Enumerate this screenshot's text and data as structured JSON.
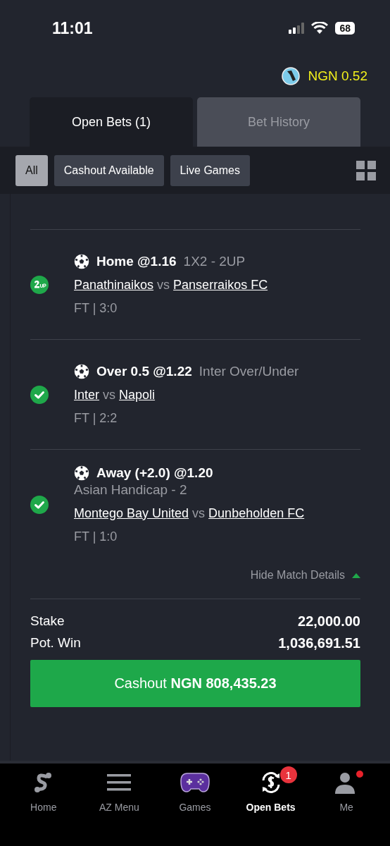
{
  "status_bar": {
    "time": "11:01",
    "battery": "68"
  },
  "balance": {
    "amount": "NGN 0.52"
  },
  "tabs": [
    {
      "label": "Open Bets (1)",
      "selected": true
    },
    {
      "label": "Bet History",
      "selected": false
    }
  ],
  "filters": [
    {
      "label": "All",
      "selected": true
    },
    {
      "label": "Cashout Available",
      "selected": false
    },
    {
      "label": "Live Games",
      "selected": false
    }
  ],
  "legs": [
    {
      "kind": "boosted",
      "pick": "Home @1.16",
      "market": "1X2  -  2UP",
      "home": "Panathinaikos",
      "vs": "vs",
      "away": "Panserraikos FC",
      "result": "FT | 3:0"
    },
    {
      "kind": "won",
      "pick": "Over 0.5 @1.22",
      "market": "Inter Over/Under",
      "home": "Inter",
      "vs": "vs",
      "away": "Napoli",
      "result": "FT | 2:2"
    },
    {
      "kind": "won",
      "pick": "Away (+2.0) @1.20",
      "market_line": "Asian Handicap  - 2",
      "home": "Montego Bay United",
      "vs": "vs",
      "away": "Dunbeholden FC",
      "result": "FT | 1:0"
    }
  ],
  "toggle_details": "Hide Match Details",
  "summary": [
    {
      "label": "Stake",
      "value": "22,000.00"
    },
    {
      "label": "Pot. Win",
      "value": "1,036,691.51"
    }
  ],
  "cashout": "Cashout **NGN 808,435.23**",
  "nav": [
    {
      "label": "Home",
      "kind": "logo",
      "selected": false
    },
    {
      "label": "AZ Menu",
      "kind": "menu",
      "selected": false
    },
    {
      "label": "Games",
      "kind": "gamepad",
      "selected": false
    },
    {
      "label": "Open Bets",
      "kind": "bets",
      "selected": true,
      "badge": "1"
    },
    {
      "label": "Me",
      "kind": "person",
      "selected": false,
      "dot": true
    }
  ]
}
